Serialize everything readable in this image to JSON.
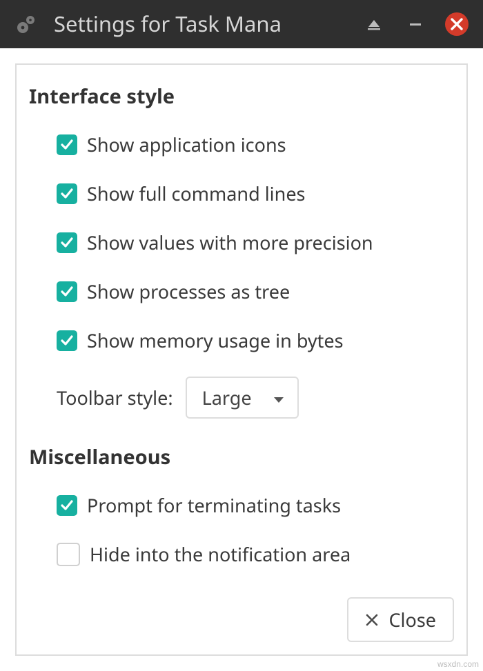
{
  "window": {
    "title": "Settings for Task Mana"
  },
  "sections": {
    "interface": {
      "heading": "Interface style",
      "options": [
        {
          "label": "Show application icons",
          "checked": true
        },
        {
          "label": "Show full command lines",
          "checked": true
        },
        {
          "label": "Show values with more precision",
          "checked": true
        },
        {
          "label": "Show processes as tree",
          "checked": true
        },
        {
          "label": "Show memory usage in bytes",
          "checked": true
        }
      ],
      "toolbar_style": {
        "label": "Toolbar style:",
        "value": "Large"
      }
    },
    "misc": {
      "heading": "Miscellaneous",
      "options": [
        {
          "label": "Prompt for terminating tasks",
          "checked": true
        },
        {
          "label": "Hide into the notification area",
          "checked": false
        }
      ]
    }
  },
  "footer": {
    "close_label": "Close"
  },
  "watermark": "wsxdn.com"
}
